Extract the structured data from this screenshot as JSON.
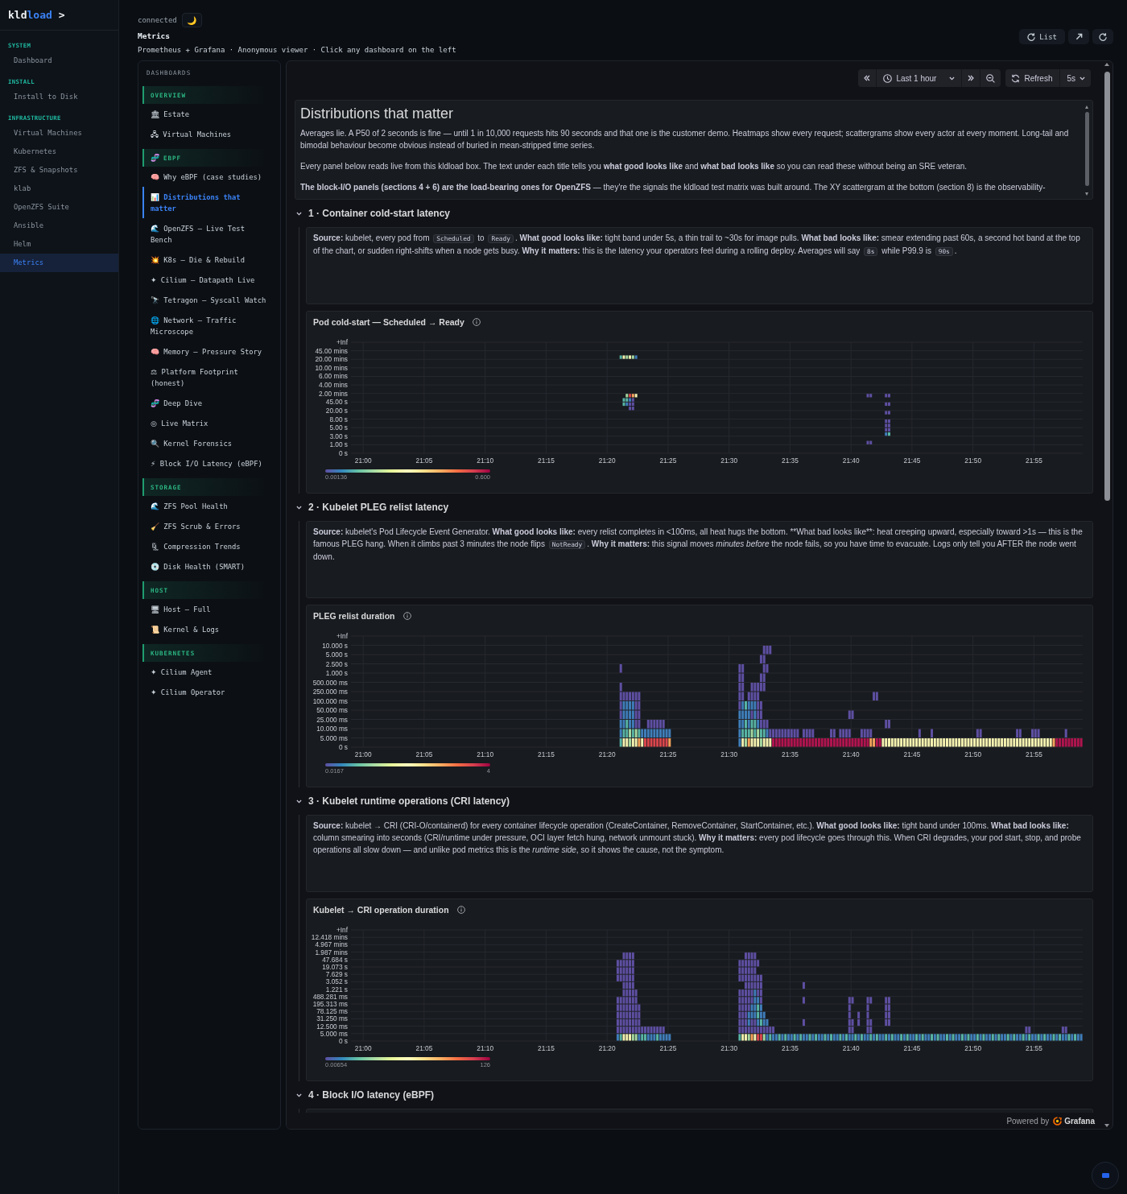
{
  "nav": {
    "logo": {
      "prefix": "kld",
      "accent": "load",
      "caret": ">"
    },
    "sections": [
      {
        "title": "SYSTEM",
        "items": [
          {
            "label": "Dashboard",
            "selected": false
          }
        ]
      },
      {
        "title": "INSTALL",
        "items": [
          {
            "label": "Install to Disk",
            "selected": false
          }
        ]
      },
      {
        "title": "INFRASTRUCTURE",
        "items": [
          {
            "label": "Virtual Machines",
            "selected": false
          },
          {
            "label": "Kubernetes",
            "selected": false
          },
          {
            "label": "ZFS & Snapshots",
            "selected": false
          },
          {
            "label": "klab",
            "selected": false
          },
          {
            "label": "OpenZFS Suite",
            "selected": false
          },
          {
            "label": "Ansible",
            "selected": false
          },
          {
            "label": "Helm",
            "selected": false
          },
          {
            "label": "Metrics",
            "selected": true
          }
        ]
      }
    ]
  },
  "header": {
    "status": "connected",
    "theme_toggle": "🌙",
    "title": "Metrics",
    "subtitle": "Prometheus + Grafana · Anonymous viewer · Click any dashboard on the left",
    "list_button": "List"
  },
  "dashboards": {
    "heading": "DASHBOARDS",
    "groups": [
      {
        "title": "OVERVIEW",
        "items": [
          {
            "glyph": "🏛",
            "label": "Estate",
            "selected": false
          },
          {
            "glyph": "🖧",
            "label": "Virtual Machines",
            "selected": false
          }
        ]
      },
      {
        "glyph": "🧬",
        "title": "EBPF",
        "items": [
          {
            "glyph": "🧠",
            "label": "Why eBPF (case studies)",
            "selected": false
          },
          {
            "glyph": "📊",
            "label": "Distributions that matter",
            "selected": true
          },
          {
            "glyph": "🌊",
            "label": "OpenZFS — Live Test Bench",
            "selected": false
          },
          {
            "glyph": "💥",
            "label": "K8s — Die & Rebuild",
            "selected": false
          },
          {
            "glyph": "✦",
            "label": "Cilium — Datapath Live",
            "selected": false
          },
          {
            "glyph": "🔭",
            "label": "Tetragon — Syscall Watch",
            "selected": false
          },
          {
            "glyph": "🌐",
            "label": "Network — Traffic Microscope",
            "selected": false
          },
          {
            "glyph": "🧠",
            "label": "Memory — Pressure Story",
            "selected": false
          },
          {
            "glyph": "⚖",
            "label": "Platform Footprint (honest)",
            "selected": false
          },
          {
            "glyph": "🧬",
            "label": "Deep Dive",
            "selected": false
          },
          {
            "glyph": "◎",
            "label": "Live Matrix",
            "selected": false
          },
          {
            "glyph": "🔍",
            "label": "Kernel Forensics",
            "selected": false
          },
          {
            "glyph": "⚡",
            "label": "Block I/O Latency (eBPF)",
            "selected": false
          }
        ]
      },
      {
        "title": "STORAGE",
        "items": [
          {
            "glyph": "🌊",
            "label": "ZFS Pool Health",
            "selected": false
          },
          {
            "glyph": "🧹",
            "label": "ZFS Scrub & Errors",
            "selected": false
          },
          {
            "glyph": "🗜",
            "label": "Compression Trends",
            "selected": false
          },
          {
            "glyph": "💿",
            "label": "Disk Health (SMART)",
            "selected": false
          }
        ]
      },
      {
        "title": "HOST",
        "items": [
          {
            "glyph": "🖥",
            "label": "Host — Full",
            "selected": false
          },
          {
            "glyph": "📜",
            "label": "Kernel & Logs",
            "selected": false
          }
        ]
      },
      {
        "title": "KUBERNETES",
        "items": [
          {
            "glyph": "✦",
            "label": "Cilium Agent",
            "selected": false
          },
          {
            "glyph": "✦",
            "label": "Cilium Operator",
            "selected": false
          }
        ]
      }
    ]
  },
  "grafana": {
    "toolbar": {
      "time_range": "Last 1 hour",
      "refresh_label": "Refresh",
      "refresh_interval": "5s"
    },
    "intro": {
      "title": "Distributions that matter",
      "paragraphs": [
        "Averages lie. A P50 of 2 seconds is fine — until 1 in 10,000 requests hits 90 seconds and that one is the customer demo. Heatmaps show every request; scattergrams show every actor at every moment. Long-tail and bimodal behaviour become obvious instead of buried in mean-stripped time series.",
        "Every panel below reads live from this kldload box. The text under each title tells you **what good looks like** and **what bad looks like** so you can read these without being an SRE veteran.",
        "**The block-I/O panels (sections 4 + 6) are the load-bearing ones for OpenZFS** — they're the signals the kldload test matrix was built around. The XY scattergram at the bottom (section 8) is the observability-"
      ]
    },
    "sections": [
      {
        "title": "1 · Container cold-start latency",
        "expanded": true,
        "description": [
          {
            "kind": "bold",
            "text": "Source:"
          },
          {
            "kind": "plain",
            "text": " kubelet, every pod from "
          },
          {
            "kind": "code",
            "text": "Scheduled"
          },
          {
            "kind": "plain",
            "text": " to "
          },
          {
            "kind": "code",
            "text": "Ready"
          },
          {
            "kind": "plain",
            "text": ". "
          },
          {
            "kind": "bold",
            "text": "What good looks like:"
          },
          {
            "kind": "plain",
            "text": " tight band under 5s, a thin trail to ~30s for image pulls. "
          },
          {
            "kind": "bold",
            "text": "What bad looks like:"
          },
          {
            "kind": "plain",
            "text": " smear extending past 60s, a second hot band at the top of the chart, or sudden right-shifts when a node gets busy. "
          },
          {
            "kind": "bold",
            "text": "Why it matters:"
          },
          {
            "kind": "plain",
            "text": " this is the latency your operators feel during a rolling deploy. Averages will say "
          },
          {
            "kind": "code",
            "text": "8s"
          },
          {
            "kind": "plain",
            "text": " while P99.9 is "
          },
          {
            "kind": "code",
            "text": "90s"
          },
          {
            "kind": "plain",
            "text": "."
          }
        ],
        "panel": {
          "title": "Pod cold-start — Scheduled → Ready",
          "y_labels": [
            "+Inf",
            "45.00 mins",
            "20.00 mins",
            "10.00 mins",
            "6.00 mins",
            "4.00 mins",
            "2.00 mins",
            "45.00 s",
            "20.00 s",
            "8.00 s",
            "5.00 s",
            "3.00 s",
            "1.00 s",
            "0 s"
          ],
          "x_labels": [
            "21:00",
            "21:05",
            "21:10",
            "21:15",
            "21:20",
            "21:25",
            "21:30",
            "21:35",
            "21:40",
            "21:45",
            "21:50",
            "21:55"
          ],
          "legend": {
            "min": "0.00136",
            "max": "0.600"
          }
        }
      },
      {
        "title": "2 · Kubelet PLEG relist latency",
        "expanded": true,
        "description": [
          {
            "kind": "bold",
            "text": "Source:"
          },
          {
            "kind": "plain",
            "text": " kubelet's Pod Lifecycle Event Generator. "
          },
          {
            "kind": "bold",
            "text": "What good looks like:"
          },
          {
            "kind": "plain",
            "text": " every relist completes in <100ms, all heat hugs the bottom. **What bad looks like**: heat creeping upward, especially toward >1s — this is the famous PLEG hang. When it climbs past 3 minutes the node flips "
          },
          {
            "kind": "code",
            "text": "NotReady"
          },
          {
            "kind": "plain",
            "text": ". "
          },
          {
            "kind": "bold",
            "text": "Why it matters:"
          },
          {
            "kind": "plain",
            "text": " this signal moves "
          },
          {
            "kind": "italic",
            "text": "minutes before"
          },
          {
            "kind": "plain",
            "text": " the node fails, so you have time to evacuate. Logs only tell you AFTER the node went down."
          }
        ],
        "panel": {
          "title": "PLEG relist duration",
          "y_labels": [
            "+Inf",
            "10.000 s",
            "5.000 s",
            "2.500 s",
            "1.000 s",
            "500.000 ms",
            "250.000 ms",
            "100.000 ms",
            "50.000 ms",
            "25.000 ms",
            "10.000 ms",
            "5.000 ms",
            "0 s"
          ],
          "x_labels": [
            "21:00",
            "21:05",
            "21:10",
            "21:15",
            "21:20",
            "21:25",
            "21:30",
            "21:35",
            "21:40",
            "21:45",
            "21:50",
            "21:55"
          ],
          "legend": {
            "min": "0.0167",
            "max": "4"
          }
        }
      },
      {
        "title": "3 · Kubelet runtime operations (CRI latency)",
        "expanded": true,
        "description": [
          {
            "kind": "bold",
            "text": "Source:"
          },
          {
            "kind": "plain",
            "text": " kubelet → CRI (CRI-O/containerd) for every container lifecycle operation (CreateContainer, RemoveContainer, StartContainer, etc.). "
          },
          {
            "kind": "bold",
            "text": "What good looks like:"
          },
          {
            "kind": "plain",
            "text": " tight band under 100ms. "
          },
          {
            "kind": "bold",
            "text": "What bad looks like:"
          },
          {
            "kind": "plain",
            "text": " column smearing into seconds (CRI/runtime under pressure, OCI layer fetch hung, network unmount stuck). "
          },
          {
            "kind": "bold",
            "text": "Why it matters:"
          },
          {
            "kind": "plain",
            "text": " every pod lifecycle goes through this. When CRI degrades, your pod start, stop, and probe operations all slow down — and unlike pod metrics this is the "
          },
          {
            "kind": "italic",
            "text": "runtime side"
          },
          {
            "kind": "plain",
            "text": ", so it shows the cause, not the symptom."
          }
        ],
        "panel": {
          "title": "Kubelet → CRI operation duration",
          "y_labels": [
            "+Inf",
            "12.418 mins",
            "4.967 mins",
            "1.987 mins",
            "47.684 s",
            "19.073 s",
            "7.629 s",
            "3.052 s",
            "1.221 s",
            "488.281 ms",
            "195.313 ms",
            "78.125 ms",
            "31.250 ms",
            "12.500 ms",
            "5.000 ms",
            "0 s"
          ],
          "x_labels": [
            "21:00",
            "21:05",
            "21:10",
            "21:15",
            "21:20",
            "21:25",
            "21:30",
            "21:35",
            "21:40",
            "21:45",
            "21:50",
            "21:55"
          ],
          "legend": {
            "min": "0.00654",
            "max": "126"
          }
        }
      },
      {
        "title": "4 · Block I/O latency (eBPF)",
        "expanded": true
      }
    ],
    "footer": {
      "prefix": "Powered by",
      "brand": "Grafana"
    }
  }
}
